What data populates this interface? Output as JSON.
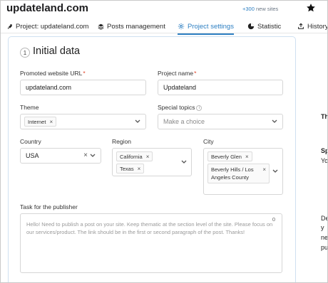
{
  "header": {
    "site_title": "updateland.com",
    "new_sites_count": "+300",
    "new_sites_label": "new sites"
  },
  "tabs": [
    {
      "label": "Project: updateland.com",
      "icon": "rocket-icon"
    },
    {
      "label": "Posts management",
      "icon": "layers-icon"
    },
    {
      "label": "Project settings",
      "icon": "gear-icon",
      "active": true
    },
    {
      "label": "Statistic",
      "icon": "pie-chart-icon"
    },
    {
      "label": "History",
      "icon": "export-icon"
    }
  ],
  "card": {
    "step": "1",
    "title": "Initial data",
    "promoted_url": {
      "label": "Promoted website URL",
      "value": "updateland.com"
    },
    "project_name": {
      "label": "Project name",
      "value": "Updateland"
    },
    "theme": {
      "label": "Theme",
      "chip": "Internet"
    },
    "special_topics": {
      "label": "Special topics",
      "placeholder": "Make a choice"
    },
    "country": {
      "label": "Country",
      "value": "USA"
    },
    "region": {
      "label": "Region",
      "chips": [
        "California",
        "Texas"
      ]
    },
    "city": {
      "label": "City",
      "chips": [
        "Beverly Glen",
        "Beverly Hills / Los Angeles County"
      ]
    },
    "task": {
      "label": "Task for the publisher",
      "counter": "0",
      "placeholder": "Hello! Need to publish a post on your site. Keep thematic at the section level of the site. Please focus on our services/product. The link should be in the first or second paragraph of the post. Thanks!"
    }
  },
  "side_partial": [
    "Th",
    "Sp",
    "Yo",
    "De",
    "y",
    "ne",
    "pu"
  ],
  "colors": {
    "accent": "#2d7fc2",
    "required": "#e0452a",
    "card_border": "#cfe0f1"
  }
}
